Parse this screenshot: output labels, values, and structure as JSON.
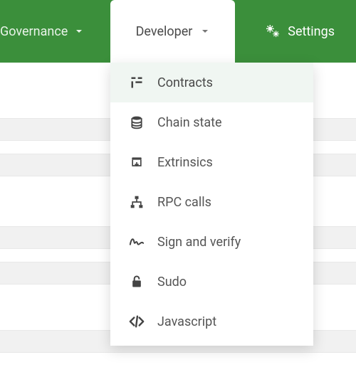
{
  "nav": {
    "governance_label": "Governance",
    "developer_label": "Developer",
    "settings_label": "Settings"
  },
  "developer_menu": {
    "items": [
      {
        "label": "Contracts",
        "icon": "contracts-icon",
        "active": true
      },
      {
        "label": "Chain state",
        "icon": "database-icon",
        "active": false
      },
      {
        "label": "Extrinsics",
        "icon": "outbox-icon",
        "active": false
      },
      {
        "label": "RPC calls",
        "icon": "network-icon",
        "active": false
      },
      {
        "label": "Sign and verify",
        "icon": "signature-icon",
        "active": false
      },
      {
        "label": "Sudo",
        "icon": "unlock-icon",
        "active": false
      },
      {
        "label": "Javascript",
        "icon": "code-icon",
        "active": false
      }
    ]
  },
  "colors": {
    "brand_green": "#3b8f3b",
    "menu_text": "#555555",
    "active_bg": "#f0f6f2"
  }
}
